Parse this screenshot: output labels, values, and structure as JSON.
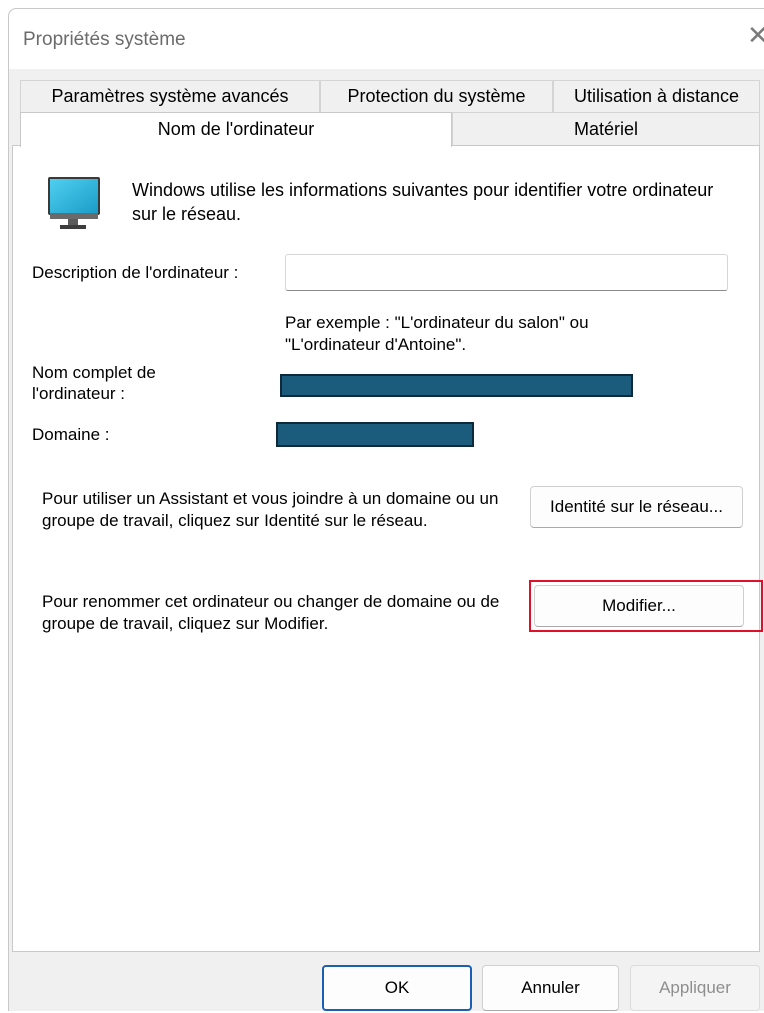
{
  "window": {
    "title": "Propriétés système",
    "close_glyph": "✕"
  },
  "tabs": {
    "row1": [
      "Paramètres système avancés",
      "Protection du système",
      "Utilisation à distance"
    ],
    "row2": [
      "Nom de l'ordinateur",
      "Matériel"
    ],
    "active": "Nom de l'ordinateur"
  },
  "computer_name_tab": {
    "icon": "monitor-icon",
    "intro": "Windows utilise les informations suivantes pour identifier votre ordinateur sur le réseau.",
    "description_label": "Description de l'ordinateur :",
    "description_value": "",
    "description_placeholder": "",
    "hint_line1": "Par exemple : \"L'ordinateur du salon\" ou",
    "hint_line2": "\"L'ordinateur d'Antoine\".",
    "full_name_label_line1": "Nom complet de",
    "full_name_label_line2": "l'ordinateur :",
    "domain_label": "Domaine :",
    "network_id_text": "Pour utiliser un Assistant et vous joindre à un domaine ou un groupe de travail, cliquez sur Identité sur le réseau.",
    "network_id_button": "Identité sur le réseau...",
    "rename_text": "Pour renommer cet ordinateur ou changer de domaine ou de groupe de travail, cliquez sur Modifier.",
    "modify_button": "Modifier..."
  },
  "footer": {
    "ok": "OK",
    "cancel": "Annuler",
    "apply": "Appliquer"
  },
  "colors": {
    "redaction": "#1b5c7c",
    "highlight": "#e0102a",
    "primary_border": "#1a5fb4"
  }
}
